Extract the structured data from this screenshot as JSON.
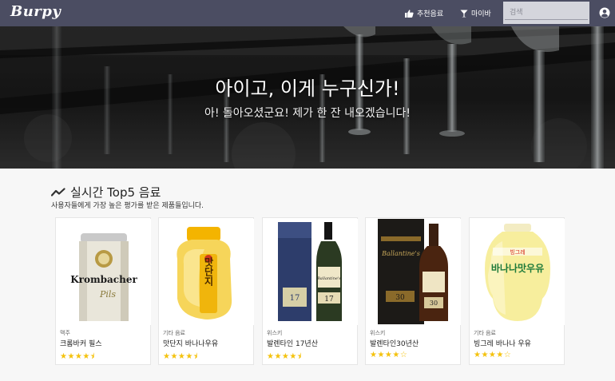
{
  "nav": {
    "logo": "Burpy",
    "recommend_label": "추천음료",
    "my_bar_label": "마이바",
    "search_placeholder": "검색"
  },
  "hero": {
    "title": "아이고, 이게 누구신가!",
    "subtitle": "아! 돌아오셨군요! 제가 한 잔 내오겠습니다!"
  },
  "section": {
    "title": "실시간 Top5 음료",
    "subtitle": "사용자들에게 가장 높은 평가를 받은 제품들입니다."
  },
  "products": [
    {
      "category": "맥주",
      "name": "크롬바커 필스",
      "rating": 4.5,
      "stars": "★★★★⯨"
    },
    {
      "category": "기타 음료",
      "name": "맛단지 바나나우유",
      "rating": 4.5,
      "stars": "★★★★⯨"
    },
    {
      "category": "위스키",
      "name": "발렌타인 17년산",
      "rating": 4.5,
      "stars": "★★★★⯨"
    },
    {
      "category": "위스키",
      "name": "발렌타인30년산",
      "rating": 4,
      "stars": "★★★★☆"
    },
    {
      "category": "기타 음료",
      "name": "빙그레 바나나 우유",
      "rating": 4,
      "stars": "★★★★☆"
    }
  ],
  "product_image_text": {
    "krombacher": "Krombacher",
    "krombacher_sub": "Pils",
    "matdanji": "맛단지",
    "ballantines": "Ballantine's",
    "age17": "17",
    "age30": "30",
    "binggrae_brand": "빙그레",
    "binggrae": "바나나맛우유"
  },
  "colors": {
    "navbar": "#4b4d62",
    "star": "#f4c20d"
  }
}
